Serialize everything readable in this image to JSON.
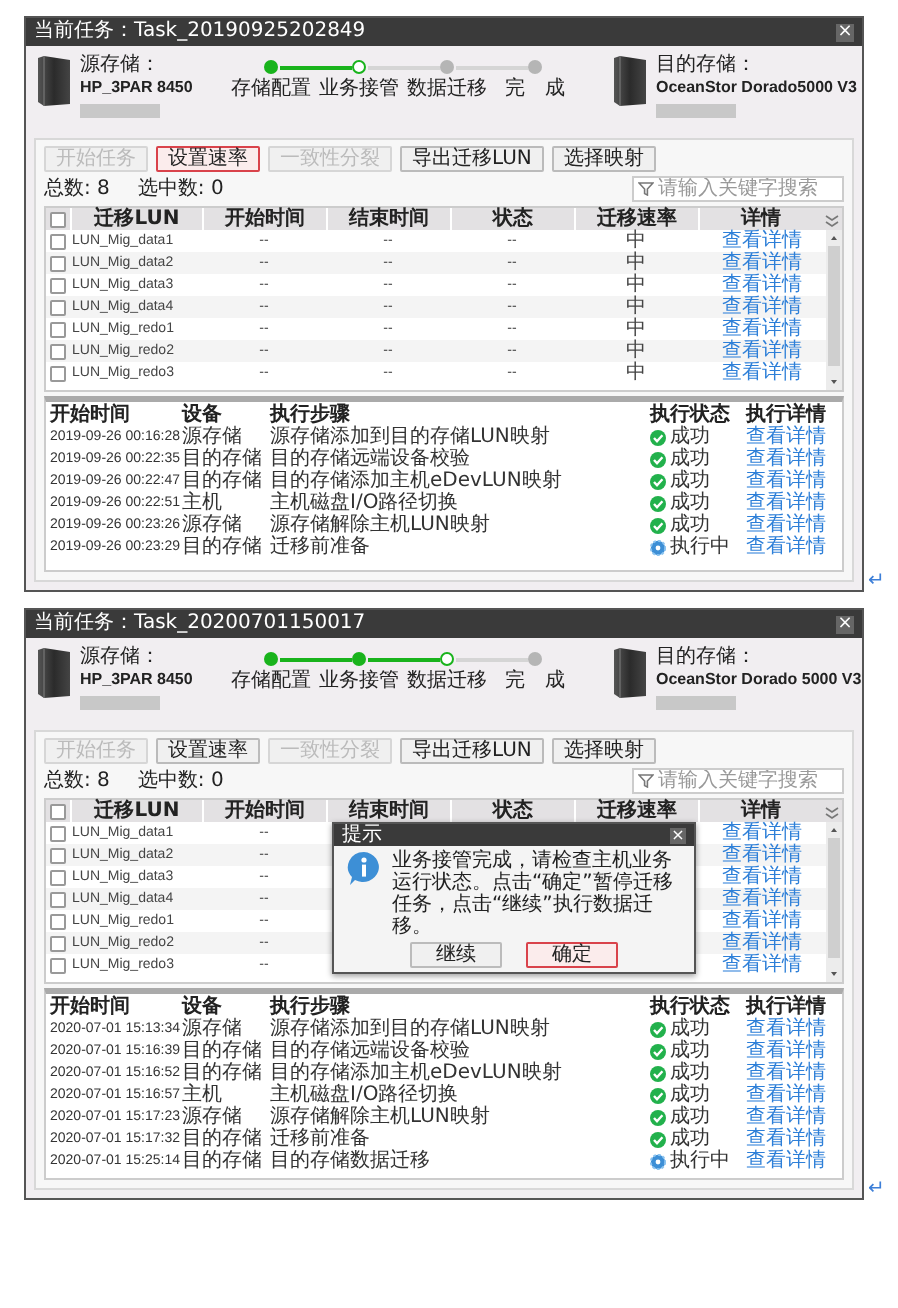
{
  "windows": [
    {
      "title": "当前任务：Task_20190925202849",
      "close": "×",
      "source": {
        "label": "源存储：",
        "name": "HP_3PAR 8450"
      },
      "target": {
        "label": "目的存储：",
        "name": "OceanStor Dorado5000 V3"
      },
      "steps": [
        {
          "label": "存储配置",
          "done": true,
          "current": false
        },
        {
          "label": "业务接管",
          "done": false,
          "current": true
        },
        {
          "label": "数据迁移",
          "done": false,
          "current": false
        },
        {
          "label": "完　成",
          "done": false,
          "current": false
        }
      ],
      "toolbar": [
        {
          "label": "开始任务",
          "disabled": true,
          "focused": false
        },
        {
          "label": "设置速率",
          "disabled": false,
          "focused": true
        },
        {
          "label": "一致性分裂",
          "disabled": true,
          "focused": false
        },
        {
          "label": "导出迁移LUN",
          "disabled": false,
          "focused": false
        },
        {
          "label": "选择映射",
          "disabled": false,
          "focused": false
        }
      ],
      "total": "总数: 8",
      "selected_count": "选中数: 0",
      "search": {
        "placeholder": "请输入关键字搜索"
      },
      "table": {
        "all_checked": false,
        "columns": [
          "迁移LUN",
          "开始时间",
          "结束时间",
          "状态",
          "迁移速率",
          "详情"
        ],
        "rows": [
          {
            "checked": false,
            "lun": "LUN_Mig_data1",
            "start": "--",
            "end": "--",
            "state": "--",
            "rate": "中",
            "detail": "查看详情"
          },
          {
            "checked": false,
            "lun": "LUN_Mig_data2",
            "start": "--",
            "end": "--",
            "state": "--",
            "rate": "中",
            "detail": "查看详情"
          },
          {
            "checked": false,
            "lun": "LUN_Mig_data3",
            "start": "--",
            "end": "--",
            "state": "--",
            "rate": "中",
            "detail": "查看详情"
          },
          {
            "checked": false,
            "lun": "LUN_Mig_data4",
            "start": "--",
            "end": "--",
            "state": "--",
            "rate": "中",
            "detail": "查看详情"
          },
          {
            "checked": false,
            "lun": "LUN_Mig_redo1",
            "start": "--",
            "end": "--",
            "state": "--",
            "rate": "中",
            "detail": "查看详情"
          },
          {
            "checked": false,
            "lun": "LUN_Mig_redo2",
            "start": "--",
            "end": "--",
            "state": "--",
            "rate": "中",
            "detail": "查看详情"
          },
          {
            "checked": false,
            "lun": "LUN_Mig_redo3",
            "start": "--",
            "end": "--",
            "state": "--",
            "rate": "中",
            "detail": "查看详情"
          }
        ]
      },
      "log": {
        "columns": [
          "开始时间",
          "设备",
          "执行步骤",
          "执行状态",
          "执行详情"
        ],
        "rows": [
          {
            "time": "2019-09-26 00:16:28",
            "device": "源存储",
            "step": "源存储添加到目的存储LUN映射",
            "status": {
              "kind": "success",
              "label": "成功"
            },
            "detail": "查看详情"
          },
          {
            "time": "2019-09-26 00:22:35",
            "device": "目的存储",
            "step": "目的存储远端设备校验",
            "status": {
              "kind": "success",
              "label": "成功"
            },
            "detail": "查看详情"
          },
          {
            "time": "2019-09-26 00:22:47",
            "device": "目的存储",
            "step": "目的存储添加主机eDevLUN映射",
            "status": {
              "kind": "success",
              "label": "成功"
            },
            "detail": "查看详情"
          },
          {
            "time": "2019-09-26 00:22:51",
            "device": "主机",
            "step": "主机磁盘I/O路径切换",
            "status": {
              "kind": "success",
              "label": "成功"
            },
            "detail": "查看详情"
          },
          {
            "time": "2019-09-26 00:23:26",
            "device": "源存储",
            "step": "源存储解除主机LUN映射",
            "status": {
              "kind": "success",
              "label": "成功"
            },
            "detail": "查看详情"
          },
          {
            "time": "2019-09-26 00:23:29",
            "device": "目的存储",
            "step": "迁移前准备",
            "status": {
              "kind": "running",
              "label": "执行中"
            },
            "detail": "查看详情"
          }
        ]
      },
      "mark": "↵"
    },
    {
      "title": "当前任务：Task_20200701150017",
      "close": "×",
      "source": {
        "label": "源存储：",
        "name": "HP_3PAR 8450"
      },
      "target": {
        "label": "目的存储：",
        "name": "OceanStor Dorado 5000 V3"
      },
      "steps": [
        {
          "label": "存储配置",
          "done": true,
          "current": false
        },
        {
          "label": "业务接管",
          "done": true,
          "current": false
        },
        {
          "label": "数据迁移",
          "done": false,
          "current": true
        },
        {
          "label": "完　成",
          "done": false,
          "current": false
        }
      ],
      "toolbar": [
        {
          "label": "开始任务",
          "disabled": true,
          "focused": false
        },
        {
          "label": "设置速率",
          "disabled": false,
          "focused": false
        },
        {
          "label": "一致性分裂",
          "disabled": true,
          "focused": false
        },
        {
          "label": "导出迁移LUN",
          "disabled": false,
          "focused": false
        },
        {
          "label": "选择映射",
          "disabled": false,
          "focused": false
        }
      ],
      "total": "总数: 8",
      "selected_count": "选中数: 0",
      "search": {
        "placeholder": "请输入关键字搜索"
      },
      "table": {
        "all_checked": false,
        "columns": [
          "迁移LUN",
          "开始时间",
          "结束时间",
          "状态",
          "迁移速率",
          "详情"
        ],
        "rows": [
          {
            "checked": false,
            "lun": "LUN_Mig_data1",
            "start": "--",
            "detail": "查看详情"
          },
          {
            "checked": false,
            "lun": "LUN_Mig_data2",
            "start": "--",
            "detail": "查看详情"
          },
          {
            "checked": false,
            "lun": "LUN_Mig_data3",
            "start": "--",
            "detail": "查看详情"
          },
          {
            "checked": false,
            "lun": "LUN_Mig_data4",
            "start": "--",
            "detail": "查看详情"
          },
          {
            "checked": false,
            "lun": "LUN_Mig_redo1",
            "start": "--",
            "detail": "查看详情"
          },
          {
            "checked": false,
            "lun": "LUN_Mig_redo2",
            "start": "--",
            "detail": "查看详情"
          },
          {
            "checked": false,
            "lun": "LUN_Mig_redo3",
            "start": "--",
            "detail": "查看详情"
          }
        ]
      },
      "dialog": {
        "title": "提示",
        "close": "×",
        "message": "业务接管完成，请检查主机业务运行状态。点击“确定”暂停迁移任务，点击“继续”执行数据迁移。",
        "buttons": [
          {
            "label": "继续",
            "focused": false
          },
          {
            "label": "确定",
            "focused": true
          }
        ]
      },
      "log": {
        "columns": [
          "开始时间",
          "设备",
          "执行步骤",
          "执行状态",
          "执行详情"
        ],
        "rows": [
          {
            "time": "2020-07-01 15:13:34",
            "device": "源存储",
            "step": "源存储添加到目的存储LUN映射",
            "status": {
              "kind": "success",
              "label": "成功"
            },
            "detail": "查看详情"
          },
          {
            "time": "2020-07-01 15:16:39",
            "device": "目的存储",
            "step": "目的存储远端设备校验",
            "status": {
              "kind": "success",
              "label": "成功"
            },
            "detail": "查看详情"
          },
          {
            "time": "2020-07-01 15:16:52",
            "device": "目的存储",
            "step": "目的存储添加主机eDevLUN映射",
            "status": {
              "kind": "success",
              "label": "成功"
            },
            "detail": "查看详情"
          },
          {
            "time": "2020-07-01 15:16:57",
            "device": "主机",
            "step": "主机磁盘I/O路径切换",
            "status": {
              "kind": "success",
              "label": "成功"
            },
            "detail": "查看详情"
          },
          {
            "time": "2020-07-01 15:17:23",
            "device": "源存储",
            "step": "源存储解除主机LUN映射",
            "status": {
              "kind": "success",
              "label": "成功"
            },
            "detail": "查看详情"
          },
          {
            "time": "2020-07-01 15:17:32",
            "device": "目的存储",
            "step": "迁移前准备",
            "status": {
              "kind": "success",
              "label": "成功"
            },
            "detail": "查看详情"
          },
          {
            "time": "2020-07-01 15:25:14",
            "device": "目的存储",
            "step": "目的存储数据迁移",
            "status": {
              "kind": "running",
              "label": "执行中"
            },
            "detail": "查看详情"
          }
        ]
      },
      "mark": "↵"
    }
  ]
}
